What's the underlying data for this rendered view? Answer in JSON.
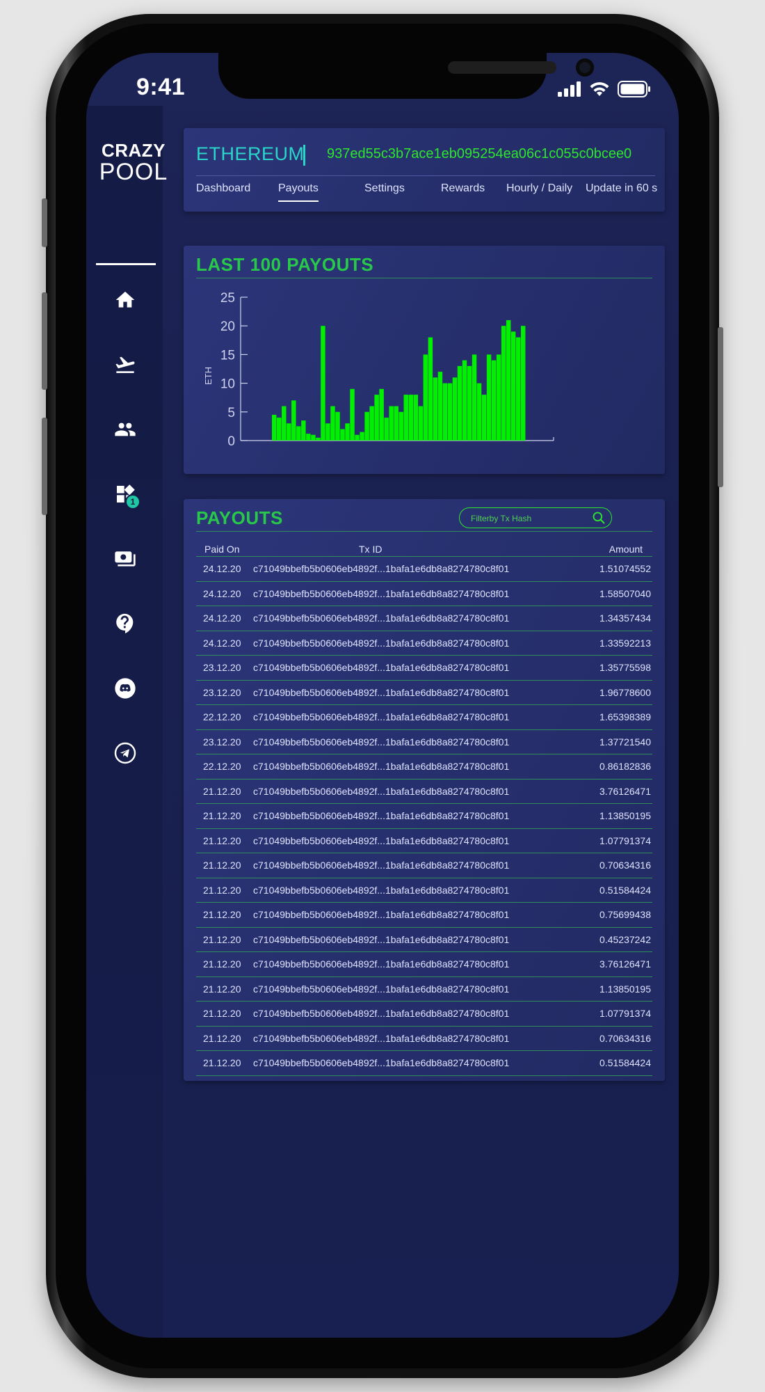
{
  "status_bar": {
    "time": "9:41"
  },
  "brand": {
    "line1": "CRAZY",
    "line2": "POOL"
  },
  "sidebar": {
    "items": [
      {
        "icon": "home-icon"
      },
      {
        "icon": "departure-icon"
      },
      {
        "icon": "group-icon"
      },
      {
        "icon": "widgets-icon",
        "badge": "1"
      },
      {
        "icon": "cash-icon"
      },
      {
        "icon": "help-icon"
      },
      {
        "icon": "discord-icon"
      },
      {
        "icon": "telegram-icon"
      }
    ]
  },
  "header": {
    "coin": "ETHEREUM",
    "wallet": "937ed55c3b7ace1eb095254ea06c1c055c0bcee0",
    "tabs": [
      {
        "label": "Dashboard"
      },
      {
        "label": "Payouts",
        "active": true
      },
      {
        "label": "Settings"
      },
      {
        "label": "Rewards"
      },
      {
        "label": "Hourly / Daily"
      },
      {
        "label": "Update in 60 s"
      }
    ]
  },
  "chart_section": {
    "title": "LAST 100 PAYOUTS"
  },
  "chart_data": {
    "type": "bar",
    "title": "LAST 100 PAYOUTS",
    "ylabel": "ETH",
    "xlabel": "",
    "ylim": [
      0,
      25
    ],
    "yticks": [
      "0",
      "5",
      "10",
      "15",
      "20",
      "25"
    ],
    "values": [
      4.5,
      4,
      6,
      3,
      7,
      2.5,
      3.5,
      1.2,
      1,
      0.5,
      20,
      3,
      6,
      5,
      2,
      3,
      9,
      1,
      1.5,
      5,
      6,
      8,
      9,
      4,
      6,
      6,
      5,
      8,
      8,
      8,
      6,
      15,
      18,
      11,
      12,
      10,
      10,
      11,
      13,
      14,
      13,
      15,
      10,
      8,
      15,
      14,
      15,
      20,
      21,
      19,
      18,
      20
    ],
    "bar_color": "#00f000"
  },
  "payouts": {
    "title": "PAYOUTS",
    "search_placeholder": "Filterby Tx Hash",
    "columns": {
      "paid_on": "Paid On",
      "tx_id": "Tx ID",
      "amount": "Amount"
    },
    "rows": [
      {
        "date": "24.12.20",
        "tx": "c71049bbefb5b0606eb4892f...1bafa1e6db8a8274780c8f01",
        "amount": "1.51074552"
      },
      {
        "date": "24.12.20",
        "tx": "c71049bbefb5b0606eb4892f...1bafa1e6db8a8274780c8f01",
        "amount": "1.58507040"
      },
      {
        "date": "24.12.20",
        "tx": "c71049bbefb5b0606eb4892f...1bafa1e6db8a8274780c8f01",
        "amount": "1.34357434"
      },
      {
        "date": "24.12.20",
        "tx": "c71049bbefb5b0606eb4892f...1bafa1e6db8a8274780c8f01",
        "amount": "1.33592213"
      },
      {
        "date": "23.12.20",
        "tx": "c71049bbefb5b0606eb4892f...1bafa1e6db8a8274780c8f01",
        "amount": "1.35775598"
      },
      {
        "date": "23.12.20",
        "tx": "c71049bbefb5b0606eb4892f...1bafa1e6db8a8274780c8f01",
        "amount": "1.96778600"
      },
      {
        "date": "22.12.20",
        "tx": "c71049bbefb5b0606eb4892f...1bafa1e6db8a8274780c8f01",
        "amount": "1.65398389"
      },
      {
        "date": "23.12.20",
        "tx": "c71049bbefb5b0606eb4892f...1bafa1e6db8a8274780c8f01",
        "amount": "1.37721540"
      },
      {
        "date": "22.12.20",
        "tx": "c71049bbefb5b0606eb4892f...1bafa1e6db8a8274780c8f01",
        "amount": "0.86182836"
      },
      {
        "date": "21.12.20",
        "tx": "c71049bbefb5b0606eb4892f...1bafa1e6db8a8274780c8f01",
        "amount": "3.76126471"
      },
      {
        "date": "21.12.20",
        "tx": "c71049bbefb5b0606eb4892f...1bafa1e6db8a8274780c8f01",
        "amount": "1.13850195"
      },
      {
        "date": "21.12.20",
        "tx": "c71049bbefb5b0606eb4892f...1bafa1e6db8a8274780c8f01",
        "amount": "1.07791374"
      },
      {
        "date": "21.12.20",
        "tx": "c71049bbefb5b0606eb4892f...1bafa1e6db8a8274780c8f01",
        "amount": "0.70634316"
      },
      {
        "date": "21.12.20",
        "tx": "c71049bbefb5b0606eb4892f...1bafa1e6db8a8274780c8f01",
        "amount": "0.51584424"
      },
      {
        "date": "21.12.20",
        "tx": "c71049bbefb5b0606eb4892f...1bafa1e6db8a8274780c8f01",
        "amount": "0.75699438"
      },
      {
        "date": "21.12.20",
        "tx": "c71049bbefb5b0606eb4892f...1bafa1e6db8a8274780c8f01",
        "amount": "0.45237242"
      },
      {
        "date": "21.12.20",
        "tx": "c71049bbefb5b0606eb4892f...1bafa1e6db8a8274780c8f01",
        "amount": "3.76126471"
      },
      {
        "date": "21.12.20",
        "tx": "c71049bbefb5b0606eb4892f...1bafa1e6db8a8274780c8f01",
        "amount": "1.13850195"
      },
      {
        "date": "21.12.20",
        "tx": "c71049bbefb5b0606eb4892f...1bafa1e6db8a8274780c8f01",
        "amount": "1.07791374"
      },
      {
        "date": "21.12.20",
        "tx": "c71049bbefb5b0606eb4892f...1bafa1e6db8a8274780c8f01",
        "amount": "0.70634316"
      },
      {
        "date": "21.12.20",
        "tx": "c71049bbefb5b0606eb4892f...1bafa1e6db8a8274780c8f01",
        "amount": "0.51584424"
      }
    ]
  },
  "colors": {
    "accent_green": "#28c94a",
    "wallet_green": "#2ee62e",
    "coin_teal": "#2ad6c9",
    "background_navy": "#1a2150"
  }
}
